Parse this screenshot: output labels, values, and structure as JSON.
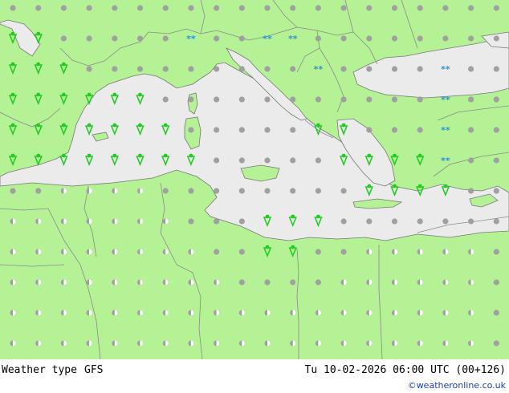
{
  "header": {
    "title": "Weather type",
    "model": "GFS",
    "valid_time": "Tu 10-02-2026 06:00 UTC (00+126)",
    "credit": "©weatheronline.co.uk"
  },
  "colors": {
    "land": "#b5f295",
    "sea": "#ebebeb",
    "border": "#8a8a8a",
    "coast": "#777777",
    "dry": "#a0a0a0",
    "rain": "#22cc22",
    "snow": "#2b90e8"
  },
  "map_grid": {
    "rows": [
      "...........................................",
      "..........................................."
    ]
  },
  "symbol_rows": [
    "VVRRR...R..RRR.....",
    "VVRRR..RSRSSS...,.,"
  ]
}
